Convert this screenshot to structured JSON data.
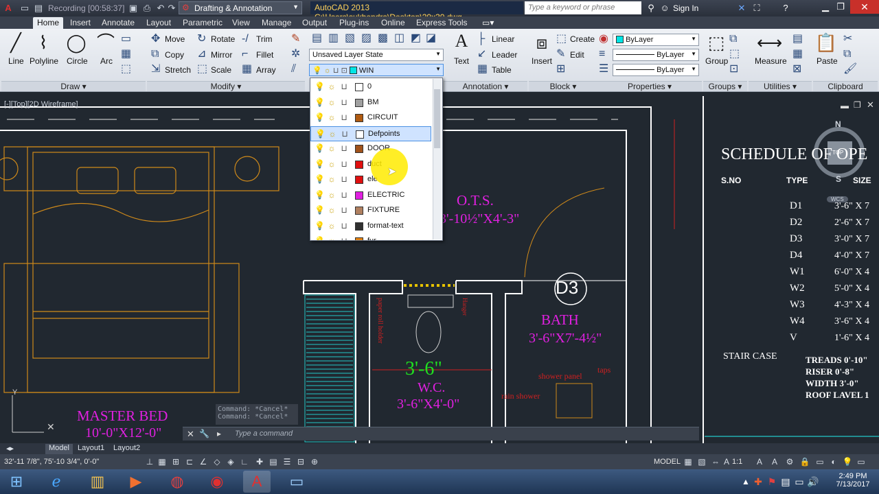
{
  "title_bar": {
    "recording": "Recording [00:58:37]",
    "workspace": "Drafting & Annotation",
    "app_title": "AutoCAD 2013   C:\\Users\\sukhendra\\Desktop\\20x30.dwg",
    "search_placeholder": "Type a keyword or phrase",
    "sign_in": "Sign In"
  },
  "tabs": [
    "Home",
    "Insert",
    "Annotate",
    "Layout",
    "Parametric",
    "View",
    "Manage",
    "Output",
    "Plug-ins",
    "Online",
    "Express Tools"
  ],
  "ribbon": {
    "draw": {
      "title": "Draw",
      "tools": [
        "Line",
        "Polyline",
        "Circle",
        "Arc"
      ]
    },
    "modify": {
      "title": "Modify",
      "tools": [
        "Move",
        "Rotate",
        "Trim",
        "Copy",
        "Mirror",
        "Fillet",
        "Stretch",
        "Scale",
        "Array"
      ]
    },
    "layers": {
      "layer_state": "Unsaved Layer State",
      "current_layer": "WIN"
    },
    "annotation": {
      "title": "Annotation",
      "tools": [
        "Text",
        "Linear",
        "Leader",
        "Table"
      ]
    },
    "block": {
      "title": "Block",
      "tools": [
        "Insert",
        "Create",
        "Edit"
      ]
    },
    "properties": {
      "title": "Properties",
      "color": "ByLayer",
      "linetype": "ByLayer",
      "lineweight": "ByLayer"
    },
    "groups": {
      "title": "Groups",
      "tools": [
        "Group"
      ]
    },
    "utilities": {
      "title": "Utilities",
      "tools": [
        "Measure"
      ]
    },
    "clipboard": {
      "title": "Clipboard",
      "tools": [
        "Paste"
      ]
    }
  },
  "layer_dropdown": {
    "layers": [
      {
        "name": "0",
        "color": "#ffffff"
      },
      {
        "name": "BM",
        "color": "#a0a0a0"
      },
      {
        "name": "CIRCUIT",
        "color": "#b05a10"
      },
      {
        "name": "Defpoints",
        "color": "#ffffff",
        "selected": true
      },
      {
        "name": "DOOR",
        "color": "#a0521a"
      },
      {
        "name": "duct",
        "color": "#e01010"
      },
      {
        "name": "ele",
        "color": "#e01010"
      },
      {
        "name": "ELECTRIC",
        "color": "#e020e0"
      },
      {
        "name": "FIXTURE",
        "color": "#b08060"
      },
      {
        "name": "format-text",
        "color": "#303030"
      },
      {
        "name": "fur",
        "color": "#e08010"
      }
    ]
  },
  "drawing": {
    "viewport_label": "[-][Top][2D Wireframe]",
    "ots_label": "O.T.S.",
    "ots_size": "3'-10½\"X4'-3\"",
    "bath_label": "BATH",
    "bath_size": "3'-6\"X7'-4½\"",
    "d3_tag": "D3",
    "wc_dim": "3'-6\"",
    "wc_label": "W.C.",
    "wc_size": "3'-6\"X4'-0\"",
    "master_bed": "MASTER BED",
    "master_bed_size": "10'-0\"X12'-0\"",
    "shower_panel": "shower panel",
    "taps": "taps",
    "rain_shower": "rain shower",
    "paper_roll_holder": "paper roll holder",
    "hanger": "Hanger",
    "compass_n": "N",
    "compass_s": "S",
    "compass_top": "TOP",
    "wcs": "WCS",
    "schedule_title": "SCHEDULE OF OPE",
    "schedule_headers": [
      "S.NO",
      "TYPE",
      "SIZE"
    ],
    "schedule_rows": [
      {
        "type": "D1",
        "size": "3'-6\" X 7"
      },
      {
        "type": "D2",
        "size": "2'-6\" X 7"
      },
      {
        "type": "D3",
        "size": "3'-0\" X 7"
      },
      {
        "type": "D4",
        "size": "4'-0\" X 7"
      },
      {
        "type": "W1",
        "size": "6'-0\" X 4"
      },
      {
        "type": "W2",
        "size": "5'-0\" X 4"
      },
      {
        "type": "W3",
        "size": "4'-3\" X 4"
      },
      {
        "type": "W4",
        "size": "3'-6\" X 4"
      },
      {
        "type": "V",
        "size": "1'-6\" X 4"
      }
    ],
    "stair_case": "STAIR CASE",
    "stair_notes": [
      "TREADS 0'-10\"",
      "RISER 0'-8\"",
      "WIDTH 3'-0\"",
      "ROOF LAVEL 1"
    ]
  },
  "command": {
    "history": [
      "Command: *Cancel*",
      "Command: *Cancel*"
    ],
    "placeholder": "Type a command"
  },
  "layout_tabs": [
    "Model",
    "Layout1",
    "Layout2"
  ],
  "status_bar": {
    "coords": "32'-11 7/8\", 75'-10 3/4\", 0'-0\"",
    "model": "MODEL",
    "scale": "1:1"
  },
  "taskbar": {
    "time": "2:49 PM",
    "date": "7/13/2017"
  }
}
